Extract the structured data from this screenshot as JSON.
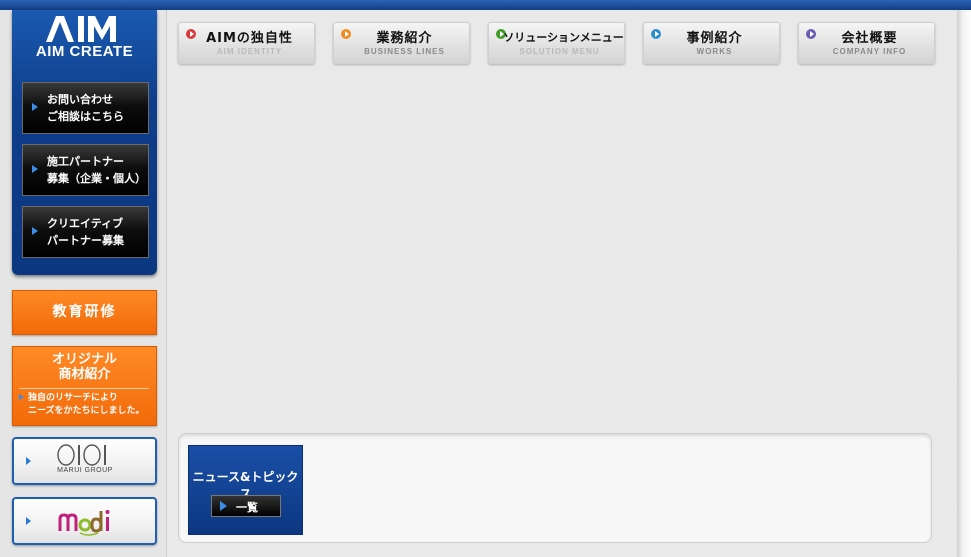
{
  "brand": {
    "logo_text": "AIM CREATE"
  },
  "sidebar": {
    "buttons": [
      {
        "line1": "お問い合わせ",
        "line2": "ご相談はこちら"
      },
      {
        "line1": "施工パートナー",
        "line2": "募集（企業・個人）"
      },
      {
        "line1": "クリエイティブ",
        "line2": "パートナー募集"
      }
    ],
    "education": "教育研修",
    "original": {
      "title1": "オリジナル",
      "title2": "商材紹介",
      "sub1": "独自のリサーチにより",
      "sub2": "ニーズをかたちにしました。"
    },
    "marui": {
      "subtitle": "MARUI GROUP"
    },
    "modi": {
      "name": "modi"
    }
  },
  "nav": [
    {
      "jp": "AIMの独自性",
      "en": "AIM IDENTITY",
      "color": "#d83a3a"
    },
    {
      "jp": "業務紹介",
      "en": "BUSINESS LINES",
      "color": "#f08a1a"
    },
    {
      "jp": "ソリューションメニュー",
      "en": "SOLUTION MENU",
      "color": "#3f9a2a"
    },
    {
      "jp": "事例紹介",
      "en": "WORKS",
      "color": "#2b8ec9"
    },
    {
      "jp": "会社概要",
      "en": "COMPANY INFO",
      "color": "#6a5bb0"
    }
  ],
  "news": {
    "title": "ニュース&トピックス",
    "list_label": "一覧"
  },
  "colors": {
    "accent_blue": "#0f3e8c",
    "accent_orange": "#f26a0a"
  }
}
